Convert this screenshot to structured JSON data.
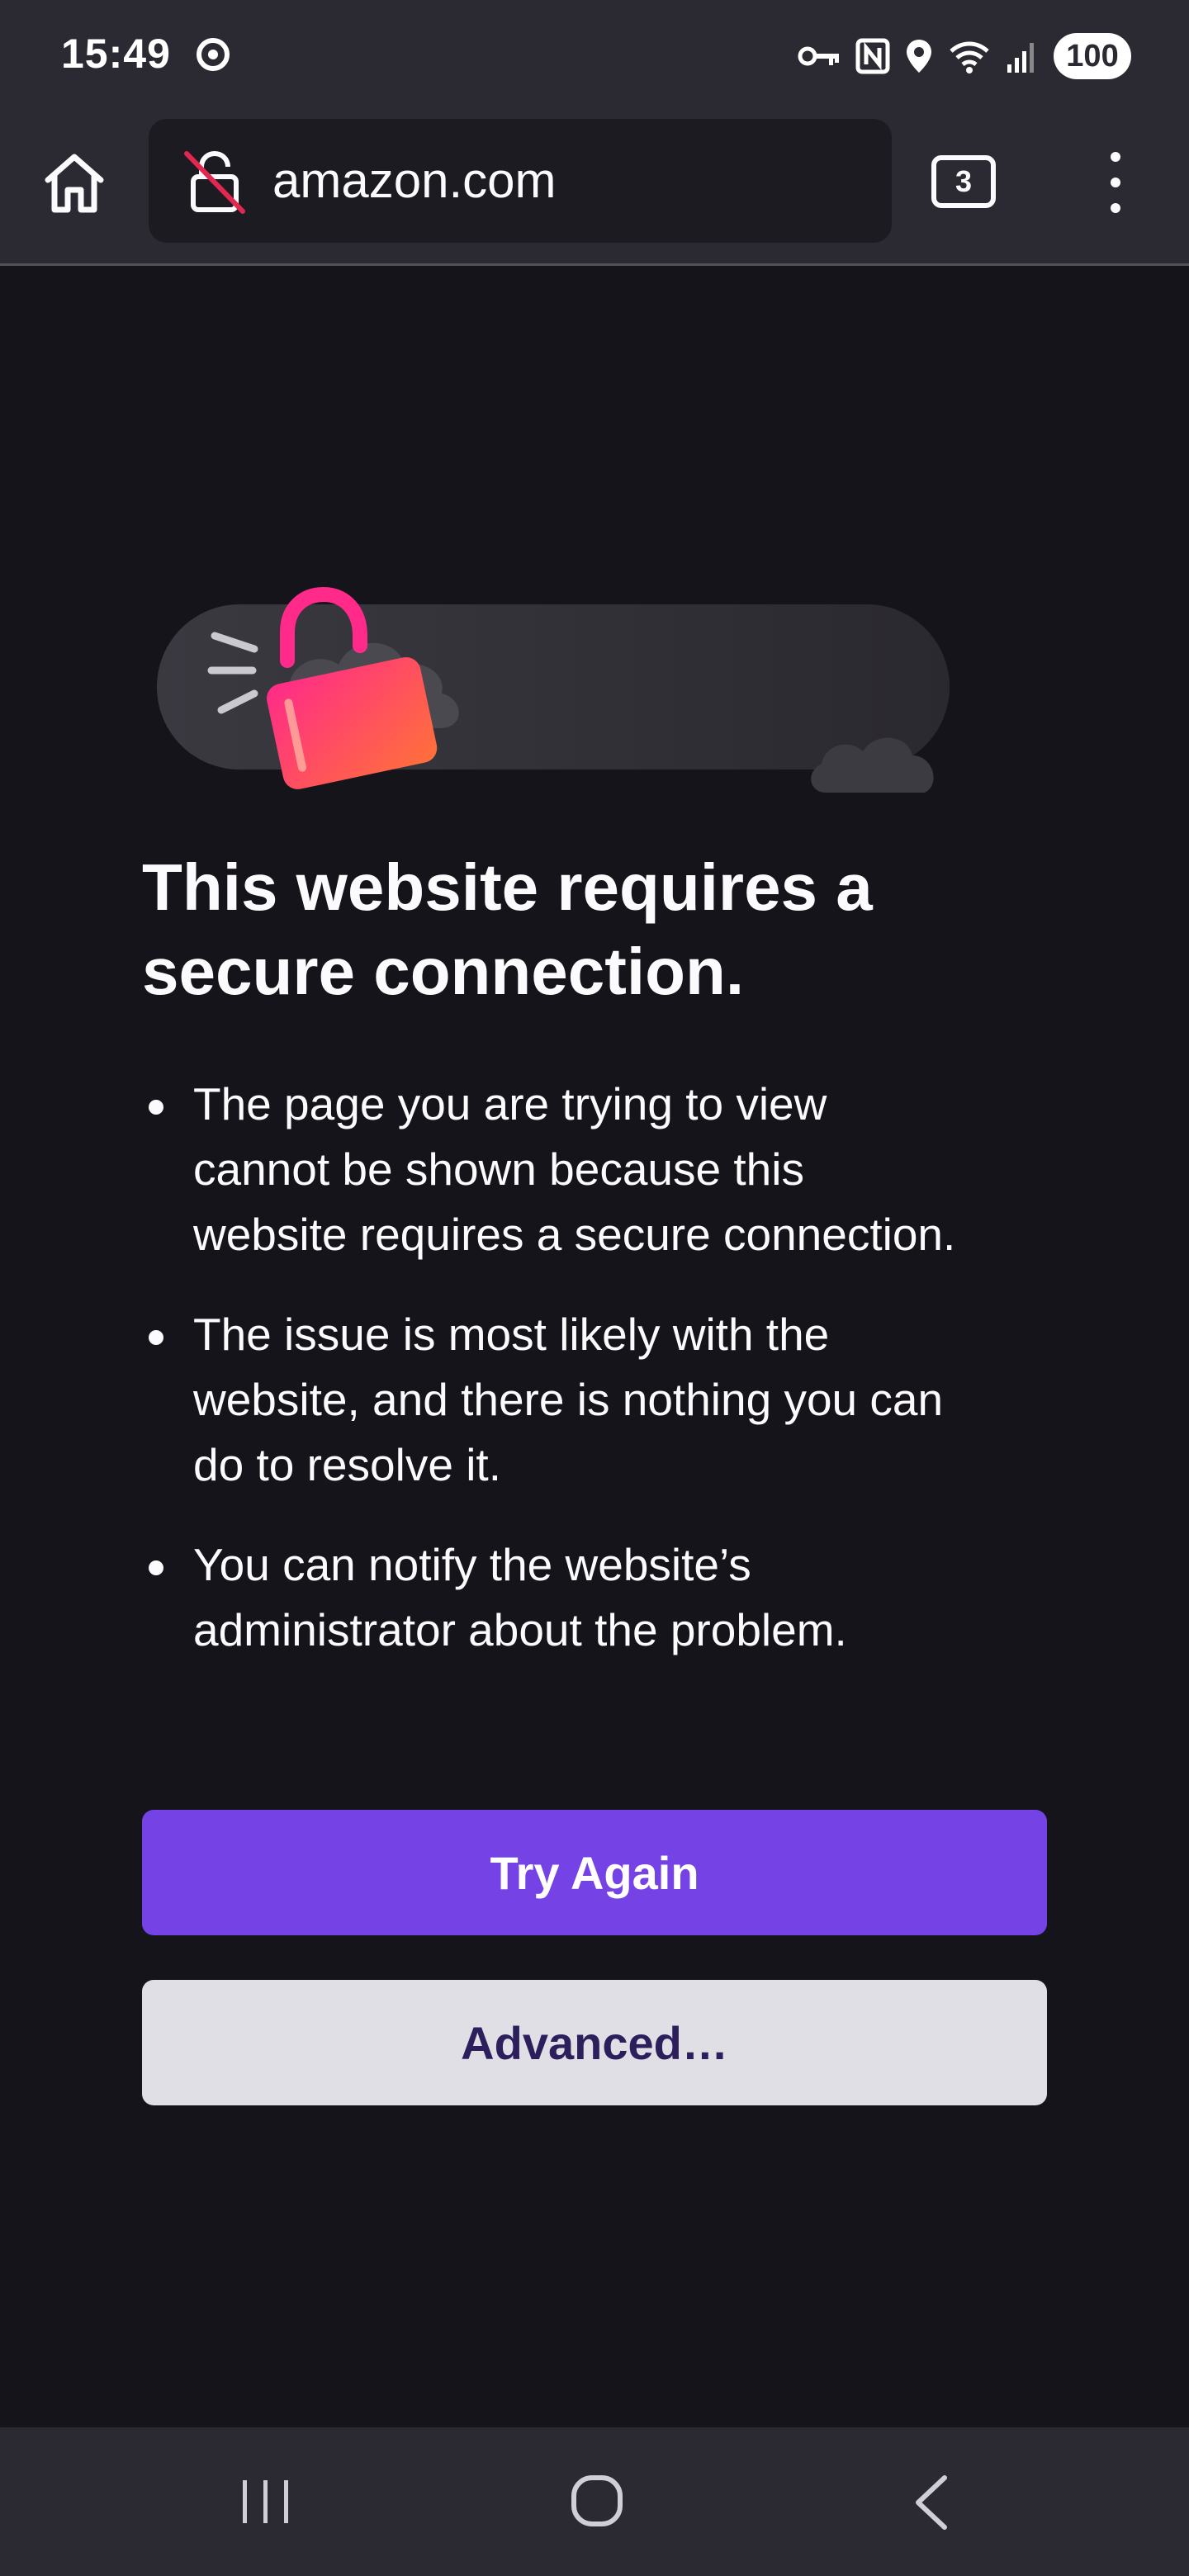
{
  "status_bar": {
    "time": "15:49",
    "battery": "100",
    "icons": [
      "sync-icon",
      "vpn-key-icon",
      "nfc-icon",
      "location-icon",
      "wifi-icon",
      "signal-icon",
      "battery-icon"
    ]
  },
  "toolbar": {
    "url": "amazon.com",
    "tab_count": "3",
    "icons": [
      "home-icon",
      "insecure-lock-icon",
      "tabs-icon",
      "more-menu-icon"
    ]
  },
  "error_page": {
    "title": "This website requires a secure connection.",
    "bullets": [
      "The page you are trying to view cannot be shown because this website requires a secure connection.",
      "The issue is most likely with the website, and there is nothing you can do to resolve it.",
      "You can notify the website’s administrator about the problem."
    ],
    "try_again_label": "Try Again",
    "advanced_label": "Advanced…"
  },
  "colors": {
    "background": "#15141a",
    "toolbar": "#2b2a33",
    "url_bar": "#1c1b22",
    "primary_button": "#7542e5",
    "secondary_button": "#e0dfe6",
    "lock_pink": "#ff3d8b",
    "lock_orange": "#ff7139"
  },
  "nav_bar": {
    "icons": [
      "recents-icon",
      "home-circle-icon",
      "back-icon"
    ]
  }
}
